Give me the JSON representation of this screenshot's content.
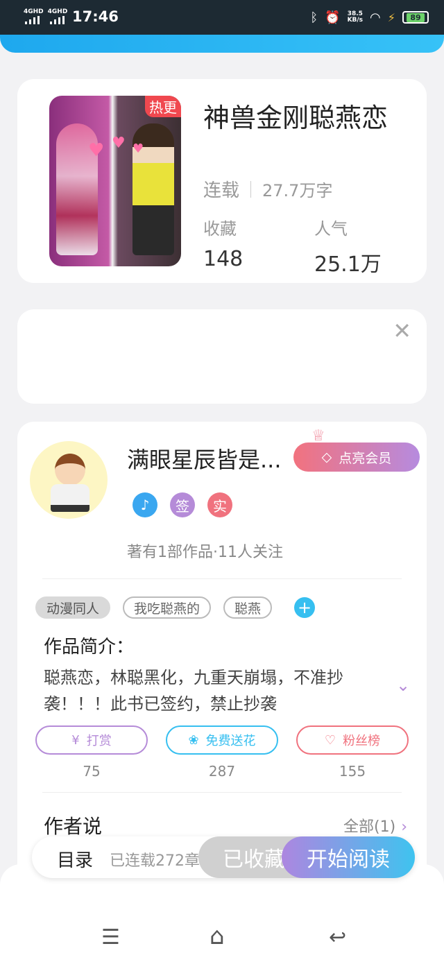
{
  "status_bar": {
    "net1": "4GHD",
    "net2": "4GHD",
    "time": "17:46",
    "speed_value": "38.5",
    "speed_unit": "KB/s",
    "battery": "89"
  },
  "book": {
    "hot_badge": "热更",
    "title": "神兽金刚聪燕恋",
    "status": "连载",
    "word_count": "27.7万字",
    "favorites_label": "收藏",
    "favorites_value": "148",
    "popularity_label": "人气",
    "popularity_value": "25.1万"
  },
  "ad": {
    "close_icon": "close-icon"
  },
  "author": {
    "name": "满眼星辰皆是...",
    "vip_button": "点亮会员",
    "badges": [
      "♪",
      "签",
      "实"
    ],
    "badge_colors": [
      "#3aa7f0",
      "#b58bd8",
      "#f0727e"
    ],
    "meta": "著有1部作品·11人关注"
  },
  "tags": [
    "动漫同人",
    "我吃聪燕的",
    "聪燕"
  ],
  "intro": {
    "title": "作品简介：",
    "text": "聪燕恋，林聪黑化，九重天崩塌，不准抄袭！！！此书已签约，禁止抄袭"
  },
  "actions": [
    {
      "icon": "¥",
      "label": "打赏",
      "count": "75",
      "color": "#b58bd8"
    },
    {
      "icon": "❀",
      "label": "免费送花",
      "count": "287",
      "color": "#36bff0"
    },
    {
      "icon": "♡",
      "label": "粉丝榜",
      "count": "155",
      "color": "#f0727e"
    }
  ],
  "author_says": {
    "title": "作者说",
    "all": "全部(1)"
  },
  "bottom": {
    "toc": "目录",
    "chapters": "已连载272章",
    "favorited": "已收藏",
    "read": "开始阅读"
  },
  "nav": {
    "menu": "☰",
    "home": "⌂",
    "back": "↩"
  }
}
